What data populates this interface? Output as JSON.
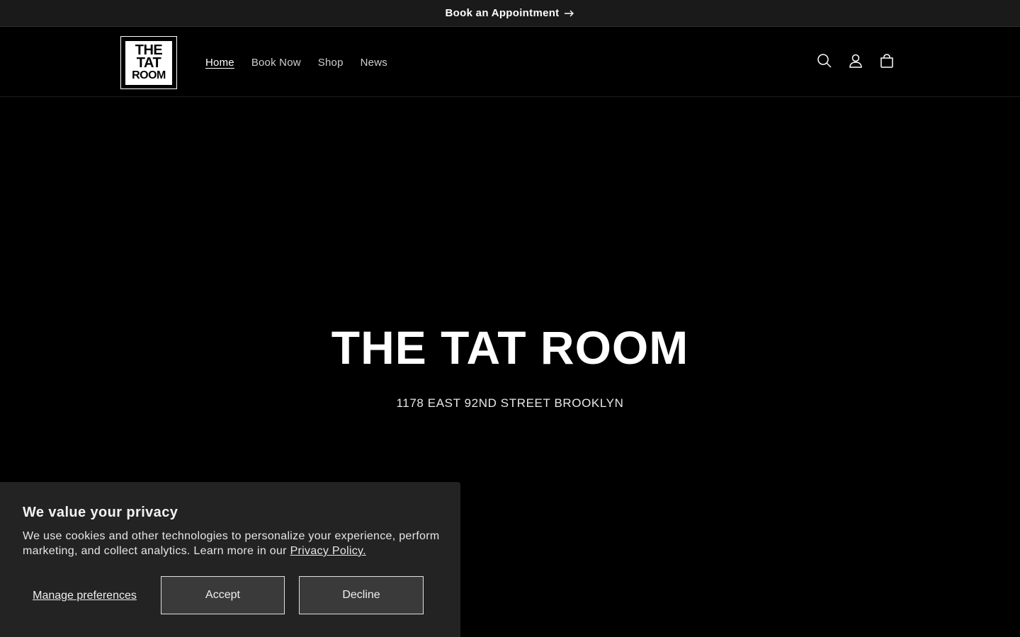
{
  "announcement": {
    "text": "Book an Appointment",
    "icon": "arrow-right-icon"
  },
  "header": {
    "logo": {
      "line1": "THE",
      "line2": "TAT",
      "line3": "ROOM"
    },
    "nav": [
      {
        "label": "Home",
        "active": true
      },
      {
        "label": "Book Now",
        "active": false
      },
      {
        "label": "Shop",
        "active": false
      },
      {
        "label": "News",
        "active": false
      }
    ],
    "icons": [
      "search-icon",
      "account-icon",
      "cart-icon"
    ]
  },
  "hero": {
    "title": "THE TAT ROOM",
    "subtitle": "1178 EAST 92ND STREET BROOKLYN"
  },
  "cookie_banner": {
    "title": "We value your privacy",
    "text": "We use cookies and other technologies to personalize your experience, perform marketing, and collect analytics. Learn more in our ",
    "link_text": "Privacy Policy.",
    "manage_label": "Manage preferences",
    "accept_label": "Accept",
    "decline_label": "Decline"
  },
  "colors": {
    "background": "#000000",
    "announcement_bg": "#1a1a1a",
    "banner_bg": "#232323",
    "button_bg": "#3a3a3a",
    "text": "#ffffff"
  }
}
